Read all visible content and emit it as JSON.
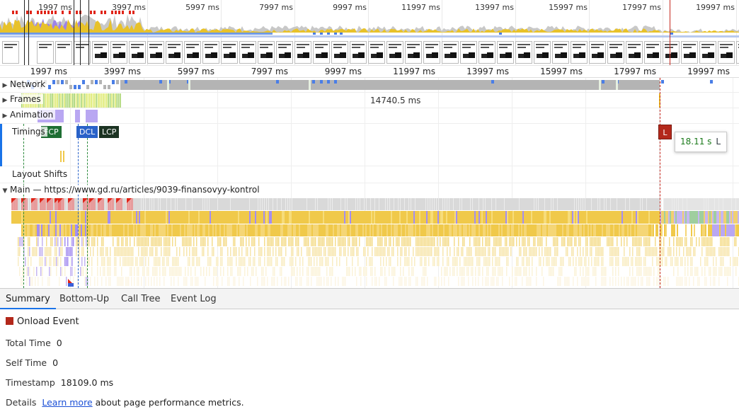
{
  "overview": {
    "ticks": [
      "1997 ms",
      "3997 ms",
      "5997 ms",
      "7997 ms",
      "9997 ms",
      "11997 ms",
      "13997 ms",
      "15997 ms",
      "17997 ms",
      "19997 ms"
    ]
  },
  "ruler": {
    "ticks": [
      "1997 ms",
      "3997 ms",
      "5997 ms",
      "7997 ms",
      "9997 ms",
      "11997 ms",
      "13997 ms",
      "15997 ms",
      "17997 ms",
      "19997 ms"
    ]
  },
  "tracks": {
    "network": "Network",
    "frames": "Frames",
    "frames_duration": "14740.5 ms",
    "animation": "Animation",
    "timings": "Timings",
    "layout_shifts": "Layout Shifts",
    "main": "Main — https://www.gd.ru/articles/9039-finansovyy-kontrol"
  },
  "markers": {
    "fcp": "FCP",
    "dcl": "DCL",
    "lcp": "LCP",
    "l": "L"
  },
  "tooltip": {
    "time": "18.11 s",
    "label": "L"
  },
  "colors": {
    "fcp": "#1e6e33",
    "dcl": "#2962c8",
    "lcp": "#1c3322",
    "onload": "#b3281b",
    "scripting": "#f0c94a",
    "rendering": "#a48ef0",
    "network_idle": "#b4b4b4",
    "accent": "#1a73e8"
  },
  "tabs": [
    "Summary",
    "Bottom-Up",
    "Call Tree",
    "Event Log"
  ],
  "summary": {
    "title": "Onload Event",
    "total_time_label": "Total Time",
    "total_time_value": "0",
    "self_time_label": "Self Time",
    "self_time_value": "0",
    "timestamp_label": "Timestamp",
    "timestamp_value": "18109.0 ms",
    "details_label": "Details",
    "details_link": "Learn more",
    "details_text": "about page performance metrics."
  }
}
